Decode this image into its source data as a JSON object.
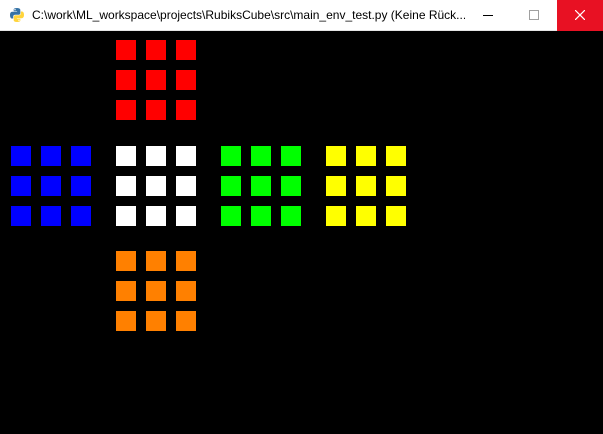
{
  "window": {
    "title": "C:\\work\\ML_workspace\\projects\\RubiksCube\\src\\main_env_test.py (Keine Rück...",
    "app_icon": "python-icon",
    "buttons": {
      "minimize_icon": "minimize-icon",
      "maximize_icon": "maximize-icon",
      "close_icon": "close-icon"
    },
    "colors": {
      "titlebar_bg": "#ffffff",
      "close_bg": "#e81123",
      "client_bg": "#000000"
    }
  },
  "cube": {
    "faces": [
      {
        "name": "up",
        "stickers": [
          "#ff0000",
          "#ff0000",
          "#ff0000",
          "#ff0000",
          "#ff0000",
          "#ff0000",
          "#ff0000",
          "#ff0000",
          "#ff0000"
        ]
      },
      {
        "name": "left",
        "stickers": [
          "#0000ff",
          "#0000ff",
          "#0000ff",
          "#0000ff",
          "#0000ff",
          "#0000ff",
          "#0000ff",
          "#0000ff",
          "#0000ff"
        ]
      },
      {
        "name": "front",
        "stickers": [
          "#ffffff",
          "#ffffff",
          "#ffffff",
          "#ffffff",
          "#ffffff",
          "#ffffff",
          "#ffffff",
          "#ffffff",
          "#ffffff"
        ]
      },
      {
        "name": "right",
        "stickers": [
          "#00ff00",
          "#00ff00",
          "#00ff00",
          "#00ff00",
          "#00ff00",
          "#00ff00",
          "#00ff00",
          "#00ff00",
          "#00ff00"
        ]
      },
      {
        "name": "back",
        "stickers": [
          "#ffff00",
          "#ffff00",
          "#ffff00",
          "#ffff00",
          "#ffff00",
          "#ffff00",
          "#ffff00",
          "#ffff00",
          "#ffff00"
        ]
      },
      {
        "name": "down",
        "stickers": [
          "#ff8000",
          "#ff8000",
          "#ff8000",
          "#ff8000",
          "#ff8000",
          "#ff8000",
          "#ff8000",
          "#ff8000",
          "#ff8000"
        ]
      }
    ]
  }
}
